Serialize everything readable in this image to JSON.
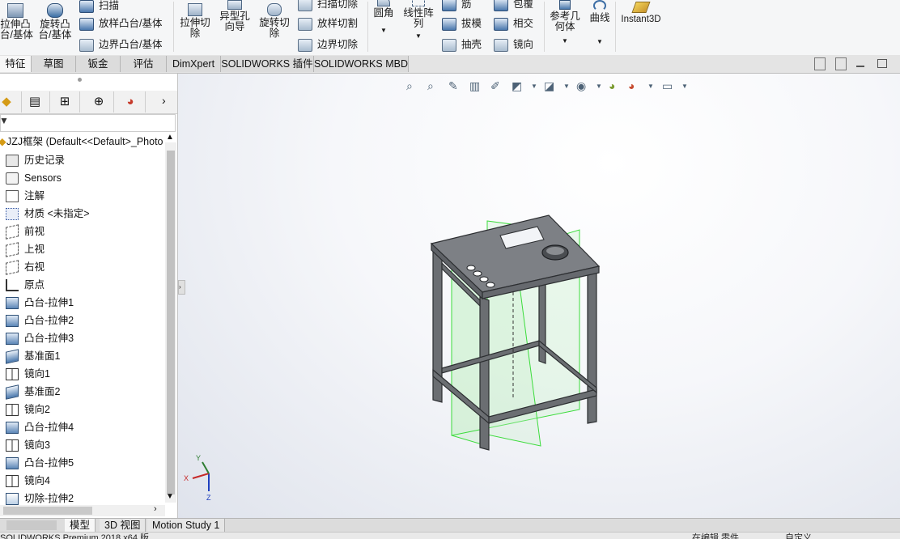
{
  "ribbon": {
    "extrude_boss": "拉伸凸\n台/基体",
    "revolve_boss": "旋转凸\n台/基体",
    "sweep": "扫描",
    "loft_boss": "放样凸台/基体",
    "boundary_boss": "边界凸台/基体",
    "extrude_cut": "拉伸切\n除",
    "hole_wizard": "异型孔\n向导",
    "revolve_cut": "旋转切\n除",
    "swept_cut": "扫描切除",
    "lofted_cut": "放样切割",
    "boundary_cut": "边界切除",
    "fillet": "圆角",
    "linear_pattern": "线性阵\n列",
    "rib": "筋",
    "draft": "拔模",
    "shell": "抽壳",
    "wrap": "包覆",
    "intersect": "相交",
    "mirror": "镜向",
    "ref_geometry": "参考几\n何体",
    "curves": "曲线",
    "instant3d": "Instant3D"
  },
  "tabs": [
    "特征",
    "草图",
    "钣金",
    "评估",
    "DimXpert",
    "SOLIDWORKS 插件",
    "SOLIDWORKS MBD"
  ],
  "tree": {
    "root": "JZJ框架  (Default<<Default>_Photo",
    "items": [
      {
        "label": "历史记录",
        "icon": "history-icon"
      },
      {
        "label": "Sensors",
        "icon": "sensors-icon"
      },
      {
        "label": "注解",
        "icon": "annotations-icon"
      },
      {
        "label": "材质 <未指定>",
        "icon": "material-icon"
      },
      {
        "label": "前视",
        "icon": "plane-icon"
      },
      {
        "label": "上视",
        "icon": "plane-icon"
      },
      {
        "label": "右视",
        "icon": "plane-icon"
      },
      {
        "label": "原点",
        "icon": "origin-icon"
      },
      {
        "label": "凸台-拉伸1",
        "icon": "extrude-icon"
      },
      {
        "label": "凸台-拉伸2",
        "icon": "extrude-icon"
      },
      {
        "label": "凸台-拉伸3",
        "icon": "extrude-icon"
      },
      {
        "label": "基准面1",
        "icon": "plane-feature-icon"
      },
      {
        "label": "镜向1",
        "icon": "mirror-icon"
      },
      {
        "label": "基准面2",
        "icon": "plane-feature-icon"
      },
      {
        "label": "镜向2",
        "icon": "mirror-icon"
      },
      {
        "label": "凸台-拉伸4",
        "icon": "extrude-icon"
      },
      {
        "label": "镜向3",
        "icon": "mirror-icon"
      },
      {
        "label": "凸台-拉伸5",
        "icon": "extrude-icon"
      },
      {
        "label": "镜向4",
        "icon": "mirror-icon"
      },
      {
        "label": "切除-拉伸2",
        "icon": "cut-icon"
      }
    ]
  },
  "bottom_tabs": [
    "模型",
    "3D 视图",
    "Motion Study 1"
  ],
  "status": {
    "left": "SOLIDWORKS Premium 2018 x64 版",
    "middle": "在编辑 零件",
    "right": "自定义"
  },
  "triad": {
    "x": "X",
    "y": "Y",
    "z": "Z"
  },
  "colors": {
    "accent": "#0a5fb3",
    "plane_edge": "#3cdc3c",
    "model": "#6b6e72"
  }
}
